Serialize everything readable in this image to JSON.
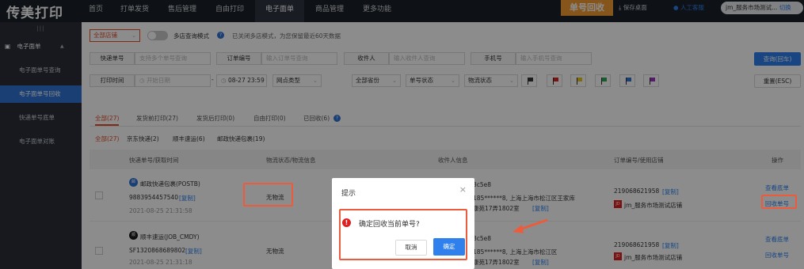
{
  "logo": "传美打印",
  "nav": {
    "items": [
      "首页",
      "打单发货",
      "售后管理",
      "自由打印",
      "电子面单",
      "商品管理",
      "更多功能"
    ],
    "active_index": 4,
    "recycle_button": "单号回收",
    "save_desktop": "保存桌面",
    "service": "人工客服",
    "account": "jm_服务市场测试...",
    "switch": "切换"
  },
  "sidebar": {
    "grip": "|||",
    "section": "电子面单",
    "items": [
      "电子面单号查询",
      "电子面单号回收",
      "快递单号底单",
      "电子面单对账"
    ],
    "active_index": 1
  },
  "filters": {
    "store_select": "全部店铺",
    "multi_store_label": "多店查询模式",
    "multi_store_note": "已关闭多店模式，为您保留最近60天数据",
    "tracking_label": "快递单号",
    "tracking_placeholder": "支持多个单号查询",
    "order_label": "订单编号",
    "order_placeholder": "输入订单号查询",
    "receiver_label": "收件人",
    "receiver_placeholder": "输入收件人查询",
    "phone_label": "手机号",
    "phone_placeholder": "输入手机号查询",
    "search_button": "查询(回车)",
    "print_time_label": "打印时间",
    "start_placeholder": "开始日期",
    "end_date": "08-27 23:59",
    "outlet_type": "网点类型",
    "province": "全部省份",
    "tracking_status": "单号状态",
    "logistics_status": "物流状态",
    "flag_colors": [
      "#333333",
      "#e02020",
      "#e6c619",
      "#2fa84f",
      "#2f73d6",
      "#9b30c9"
    ],
    "reset_button": "重置(ESC)"
  },
  "tabs": {
    "items": [
      "全部(27)",
      "发货前打印(27)",
      "发货后打印(0)",
      "自由打印(0)",
      "已回收(6)"
    ],
    "active_index": 0,
    "carriers": [
      "全部(27)",
      "京东快递(2)",
      "顺丰速运(6)",
      "邮政快递包裹(19)"
    ],
    "carrier_active_index": 0
  },
  "table": {
    "headers": [
      "快递单号/获取时间",
      "物流状态/物流信息",
      "收件人信息",
      "订单编号/使用店铺",
      "操作"
    ],
    "rows": [
      {
        "carrier": "邮政快递包裹(POSTB)",
        "tracking_no": "9883954457540",
        "copy": "[复制]",
        "time": "2021-08-25 21:31:58",
        "logistics": "无物流",
        "receiver_id": "3c5e8",
        "receiver_phone": "185******8, 上海上海市松江区王家库",
        "receiver_addr": "康苑17弄1802室",
        "receiver_copy": "[复制]",
        "order_no": "219068621958",
        "order_copy": "[复制]",
        "shop": "jm_服务市场测试店铺",
        "action_view": "查看底单",
        "action_recycle": "回收单号"
      },
      {
        "carrier": "顺丰速运(JOB_CMDY)",
        "tracking_no": "SF1320868689802",
        "copy": "[复制]",
        "time": "2021-08-25 21:31:18",
        "logistics": "无物流",
        "receiver_id": "3c5e8",
        "receiver_phone": "185******8, 上海上海市松江区",
        "receiver_addr": "康苑17弄1802室",
        "receiver_copy": "[复制]",
        "order_no": "219068621958",
        "order_copy": "[复制]",
        "shop": "jm_服务市场测试店铺",
        "action_view": "查看底单",
        "action_recycle": "回收单号"
      }
    ]
  },
  "dialog": {
    "title": "提示",
    "close": "×",
    "message": "确定回收当前单号?",
    "cancel": "取消",
    "confirm": "确定"
  }
}
